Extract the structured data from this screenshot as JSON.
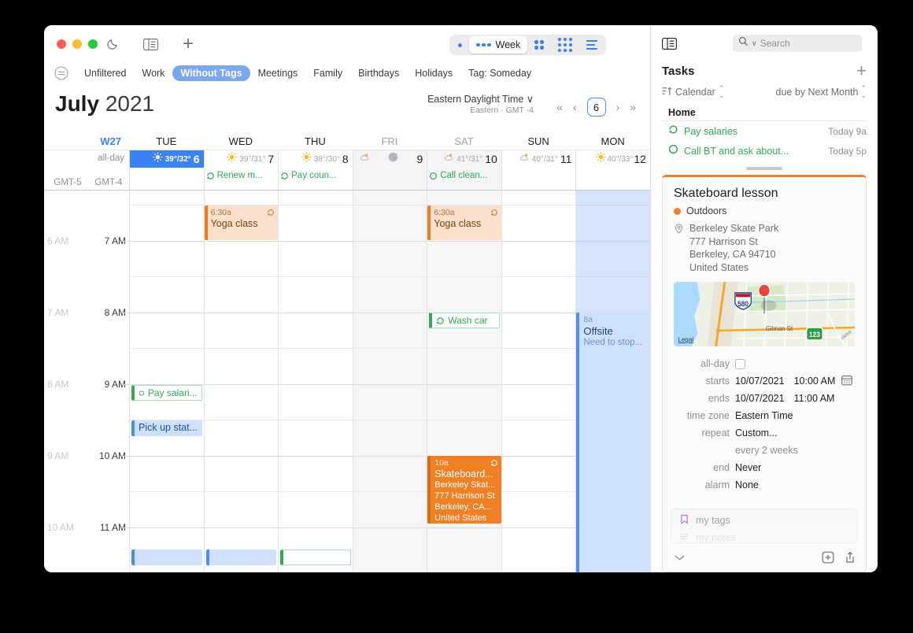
{
  "titlebar": {
    "moon_icon": "moon-icon",
    "sidebar_icon": "sidebar-toggle-icon",
    "add_icon": "plus-icon",
    "view_switcher": {
      "day_label": "",
      "week_label": "Week",
      "selected": "Week",
      "options": [
        "Day",
        "Week",
        "Month",
        "Year",
        "List"
      ]
    }
  },
  "filters": {
    "menu_icon": "filter-menu-icon",
    "chips": [
      {
        "label": "Unfiltered",
        "selected": false
      },
      {
        "label": "Work",
        "selected": false
      },
      {
        "label": "Without Tags",
        "selected": true
      },
      {
        "label": "Meetings",
        "selected": false
      },
      {
        "label": "Family",
        "selected": false
      },
      {
        "label": "Birthdays",
        "selected": false
      },
      {
        "label": "Holidays",
        "selected": false
      },
      {
        "label": "Tag: Someday",
        "selected": false
      }
    ]
  },
  "header": {
    "month": "July",
    "year": "2021",
    "timezone_primary": "Eastern Daylight Time",
    "timezone_secondary": "Eastern · GMT -4",
    "nav": {
      "first": "«",
      "prev": "‹",
      "today": "6",
      "next": "›",
      "last": "»"
    }
  },
  "week": {
    "week_number": "W27",
    "allday_label": "all-day",
    "gmt_left": "GMT-5",
    "gmt_right": "GMT-4",
    "days": [
      {
        "name": "TUE",
        "num": "6",
        "weather": "39°/32°",
        "icon": "sun-icon",
        "today": true,
        "weekend": false,
        "dim": false,
        "allday": null
      },
      {
        "name": "WED",
        "num": "7",
        "weather": "39°/31°",
        "icon": "sun-icon",
        "today": false,
        "weekend": false,
        "dim": false,
        "allday": "Renew m..."
      },
      {
        "name": "THU",
        "num": "8",
        "weather": "38°/30°",
        "icon": "sun-icon",
        "today": false,
        "weekend": false,
        "dim": false,
        "allday": "Pay coun..."
      },
      {
        "name": "FRI",
        "num": "9",
        "weather": "",
        "icon": "cloud-sun-icon",
        "today": false,
        "weekend": true,
        "dim": true,
        "allday": null
      },
      {
        "name": "SAT",
        "num": "10",
        "weather": "41°/31°",
        "icon": "cloud-sun-icon",
        "today": false,
        "weekend": true,
        "dim": true,
        "allday": "Call clean..."
      },
      {
        "name": "SUN",
        "num": "11",
        "weather": "40°/31°",
        "icon": "cloud-sun-icon",
        "today": false,
        "weekend": false,
        "dim": false,
        "allday": null
      },
      {
        "name": "MON",
        "num": "12",
        "weather": "40°/33°",
        "icon": "sun-icon",
        "today": false,
        "weekend": false,
        "dim": false,
        "allday": null
      }
    ],
    "time_labels_old": [
      "6 AM",
      "7 AM",
      "8 AM",
      "9 AM",
      "10 AM"
    ],
    "time_labels_new": [
      "7 AM",
      "8 AM",
      "9 AM",
      "10 AM",
      "11 AM"
    ],
    "events": [
      {
        "id": "yoga-wed",
        "day": 1,
        "time": "6:30a",
        "title": "Yoga class",
        "style": "orange",
        "repeat": true
      },
      {
        "id": "yoga-sat",
        "day": 4,
        "time": "6:30a",
        "title": "Yoga class",
        "style": "orange",
        "repeat": true
      },
      {
        "id": "wash-car",
        "day": 4,
        "time": "",
        "title": "Wash car",
        "style": "task",
        "repeat": true
      },
      {
        "id": "pay-salaries",
        "day": 0,
        "time": "",
        "title": "Pay salari...",
        "style": "task",
        "repeat": true
      },
      {
        "id": "pick-up-stat",
        "day": 0,
        "time": "",
        "title": "Pick up stat...",
        "style": "blue-small",
        "repeat": false
      },
      {
        "id": "offsite",
        "day": 6,
        "time": "8a",
        "title": "Offsite",
        "subtitle": "Need to stop...",
        "style": "blue",
        "repeat": false
      },
      {
        "id": "skateboard",
        "day": 4,
        "time": "10a",
        "title": "Skateboard...",
        "style": "orange-solid",
        "repeat": true,
        "lines": [
          "Berkeley Skat...",
          "777 Harrison St",
          "Berkeley, CA...",
          "United States"
        ]
      }
    ]
  },
  "right_panel": {
    "sidebar_icon": "sidebar-toggle-icon",
    "search": {
      "placeholder": "Search",
      "icon": "search-icon",
      "value": ""
    },
    "tasks": {
      "title": "Tasks",
      "add_label": "+",
      "sort_label": "Calendar",
      "sort_icon": "sort-ascending-icon",
      "filter_label": "due by Next Month",
      "group": "Home",
      "items": [
        {
          "name": "Pay salaries",
          "due": "Today 9a",
          "icon": "repeat-icon"
        },
        {
          "name": "Call BT and ask about...",
          "due": "Today 5p",
          "icon": "circle-icon"
        }
      ]
    },
    "event": {
      "title": "Skateboard lesson",
      "calendar": "Outdoors",
      "calendar_color": "#f0812a",
      "location_icon": "location-pin-icon",
      "location": [
        "Berkeley Skate Park",
        "777 Harrison St",
        "Berkeley, CA  94710",
        "United States"
      ],
      "map": {
        "legal_label": "Legal",
        "road_label": "Gilman St",
        "cross_label": "nkins",
        "shield_interstate": "580",
        "shield_route": "123",
        "pin_icon": "map-pin-icon"
      },
      "fields": [
        {
          "label": "all-day",
          "type": "checkbox",
          "value": ""
        },
        {
          "label": "starts",
          "type": "datetime",
          "date": "10/07/2021",
          "time": "10:00 AM",
          "icon": "calendar-picker-icon"
        },
        {
          "label": "ends",
          "type": "datetime",
          "date": "10/07/2021",
          "time": "11:00 AM"
        },
        {
          "label": "time zone",
          "type": "text",
          "value": "Eastern Time"
        },
        {
          "label": "repeat",
          "type": "text",
          "value": "Custom..."
        },
        {
          "label": "",
          "type": "dim",
          "value": "every 2 weeks"
        },
        {
          "label": "end",
          "type": "text",
          "value": "Never"
        },
        {
          "label": "alarm",
          "type": "text",
          "value": "None"
        }
      ],
      "tags_placeholder": "my tags",
      "notes_placeholder": "my notes",
      "tags_icon": "bookmark-icon",
      "notes_icon": "notes-icon",
      "footer": {
        "collapse_icon": "chevron-down-icon",
        "add_icon": "add-to-calendar-icon",
        "share_icon": "share-icon"
      }
    }
  }
}
